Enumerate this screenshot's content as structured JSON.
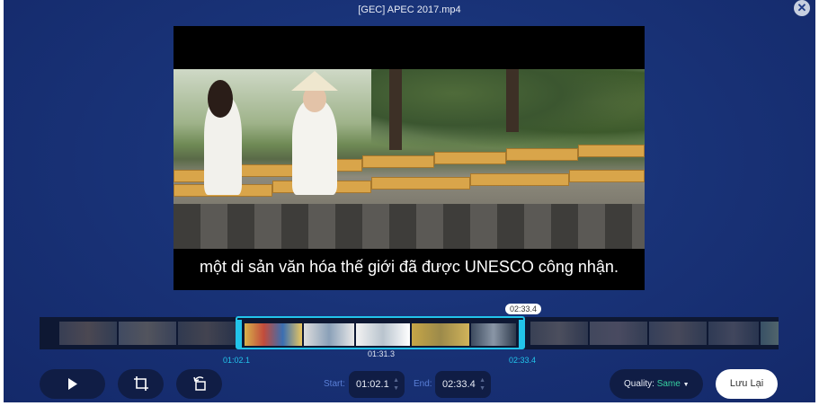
{
  "window": {
    "title": "[GEC] APEC 2017.mp4"
  },
  "video": {
    "subtitle": "một di sản văn hóa thế giới đã được UNESCO công nhận."
  },
  "timeline": {
    "start_marker": "01:02.1",
    "end_marker": "02:33.4",
    "duration_label": "01:31.3",
    "playhead_bubble": "02:33.4"
  },
  "controls": {
    "play_icon": "play-icon",
    "crop_icon": "crop-icon",
    "rotate_icon": "rotate-icon",
    "start_label": "Start:",
    "start_value": "01:02.1",
    "end_label": "End:",
    "end_value": "02:33.4",
    "quality_label": "Quality:",
    "quality_value": "Same",
    "save_label": "Lưu Lại"
  },
  "colors": {
    "accent": "#22c4ea",
    "background": "#1a347a",
    "quality_value": "#35d0a0"
  }
}
